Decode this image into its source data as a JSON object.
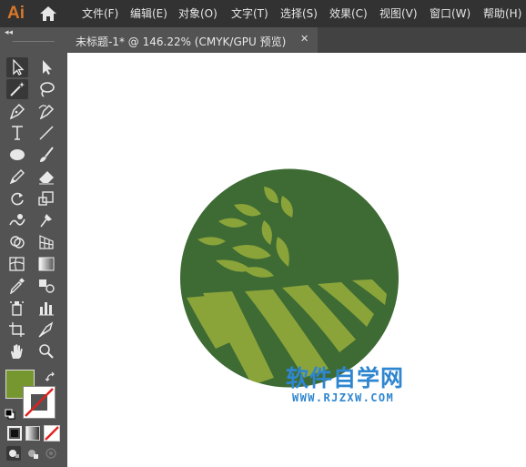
{
  "app": {
    "logo": "Ai",
    "logo_color": "#d9772a"
  },
  "menu": [
    {
      "label": "文件(F)"
    },
    {
      "label": "编辑(E)"
    },
    {
      "label": "对象(O)"
    },
    {
      "label": "文字(T)"
    },
    {
      "label": "选择(S)"
    },
    {
      "label": "效果(C)"
    },
    {
      "label": "视图(V)"
    },
    {
      "label": "窗口(W)"
    },
    {
      "label": "帮助(H)"
    }
  ],
  "toolbar": {
    "collapse_glyph": "◂◂",
    "tools": [
      {
        "name": "selection-tool",
        "active": true
      },
      {
        "name": "direct-selection-tool"
      },
      {
        "name": "magic-wand-tool",
        "active": true
      },
      {
        "name": "lasso-tool"
      },
      {
        "name": "pen-tool"
      },
      {
        "name": "curvature-tool"
      },
      {
        "name": "type-tool"
      },
      {
        "name": "line-segment-tool"
      },
      {
        "name": "ellipse-tool"
      },
      {
        "name": "paintbrush-tool"
      },
      {
        "name": "pencil-tool"
      },
      {
        "name": "eraser-tool"
      },
      {
        "name": "rotate-tool"
      },
      {
        "name": "scale-tool"
      },
      {
        "name": "warp-tool"
      },
      {
        "name": "puppet-warp-tool"
      },
      {
        "name": "shape-builder-tool"
      },
      {
        "name": "perspective-grid-tool"
      },
      {
        "name": "mesh-tool"
      },
      {
        "name": "gradient-tool"
      },
      {
        "name": "eyedropper-tool"
      },
      {
        "name": "blend-tool"
      },
      {
        "name": "symbol-sprayer-tool"
      },
      {
        "name": "column-graph-tool"
      },
      {
        "name": "artboard-tool"
      },
      {
        "name": "slice-tool"
      },
      {
        "name": "hand-tool"
      },
      {
        "name": "zoom-tool"
      }
    ],
    "fill_color": "#76962f",
    "stroke": "none"
  },
  "document_tab": {
    "label": "未标题-1* @ 146.22% (CMYK/GPU 预览)",
    "close_glyph": "✕"
  },
  "artwork": {
    "circle_color": "#3e6b34",
    "field_color": "#8ba43a",
    "leaf_color": "#8ba43a"
  },
  "watermark": {
    "text": "软件自学网",
    "url": "WWW.RJZXW.COM",
    "color": "#2f86d0"
  }
}
